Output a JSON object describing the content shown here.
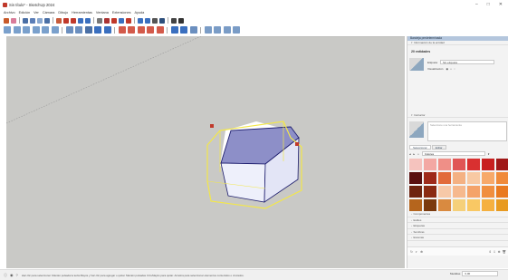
{
  "window": {
    "title": "Sin título* - SketchUp 2024",
    "controls": [
      "–",
      "□",
      "✕"
    ]
  },
  "menu": [
    "Archivo",
    "Edición",
    "Ver",
    "Cámara",
    "Dibujo",
    "Herramientas",
    "Ventana",
    "Extensiones",
    "Ayuda"
  ],
  "toolbar1_icons": [
    {
      "name": "select-icon",
      "color": "#c85a2a"
    },
    {
      "name": "eraser-icon",
      "color": "#d97c9a"
    },
    {
      "name": "pencil-icon",
      "color": "#4a6fa5"
    },
    {
      "name": "rectangle-icon",
      "color": "#5c7fb8"
    },
    {
      "name": "circle-icon",
      "color": "#8aa8d0"
    },
    {
      "name": "arc-icon",
      "color": "#4a6fa5"
    },
    {
      "name": "pushpull-icon",
      "color": "#c75b3a"
    },
    {
      "name": "move-icon",
      "color": "#c0392b"
    },
    {
      "name": "rotate-icon",
      "color": "#c0392b"
    },
    {
      "name": "scale-icon",
      "color": "#3a6fbf"
    },
    {
      "name": "offset-icon",
      "color": "#3a6fbf"
    },
    {
      "name": "tape-icon",
      "color": "#777777"
    },
    {
      "name": "dimension-icon",
      "color": "#aa3333"
    },
    {
      "name": "protractor-icon",
      "color": "#c0392b"
    },
    {
      "name": "text-icon",
      "color": "#3a6fbf"
    },
    {
      "name": "axes-icon",
      "color": "#c0392b"
    },
    {
      "name": "orbit-icon",
      "color": "#3a6fbf"
    },
    {
      "name": "pan-icon",
      "color": "#3a6fbf"
    },
    {
      "name": "zoom-icon",
      "color": "#555555"
    },
    {
      "name": "zoom-extents-icon",
      "color": "#2d4f7c"
    },
    {
      "name": "warehouse-icon",
      "color": "#444444"
    },
    {
      "name": "person-icon",
      "color": "#333333"
    }
  ],
  "toolbar2_icons": [
    {
      "name": "iso-view-icon",
      "color": "#7aa0cc"
    },
    {
      "name": "top-view-icon",
      "color": "#7aa0cc"
    },
    {
      "name": "front-view-icon",
      "color": "#7aa0cc"
    },
    {
      "name": "right-view-icon",
      "color": "#7aa0cc"
    },
    {
      "name": "back-view-icon",
      "color": "#7aa0cc"
    },
    {
      "name": "left-view-icon",
      "color": "#7aa0cc"
    },
    {
      "name": "xray-icon",
      "color": "#6b8fbf"
    },
    {
      "name": "wireframe-icon",
      "color": "#6b8fbf"
    },
    {
      "name": "hidden-line-icon",
      "color": "#4a6fa5"
    },
    {
      "name": "shaded-icon",
      "color": "#3a6fbf"
    },
    {
      "name": "textured-icon",
      "color": "#3a6fbf"
    },
    {
      "name": "monochrome-icon",
      "color": "#d35a4a"
    },
    {
      "name": "solid-union-icon",
      "color": "#d35a4a"
    },
    {
      "name": "solid-subtract-icon",
      "color": "#d35a4a"
    },
    {
      "name": "solid-trim-icon",
      "color": "#d35a4a"
    },
    {
      "name": "solid-split-icon",
      "color": "#d35a4a"
    },
    {
      "name": "section-plane-icon",
      "color": "#3a6fbf"
    },
    {
      "name": "section-cut-icon",
      "color": "#3a6fbf"
    },
    {
      "name": "sandbox-icon",
      "color": "#6b8fbf"
    },
    {
      "name": "styles-icon",
      "color": "#7a9cc6"
    },
    {
      "name": "shadows-icon",
      "color": "#7a9cc6"
    },
    {
      "name": "fog-icon",
      "color": "#7a9cc6"
    },
    {
      "name": "layers-icon",
      "color": "#7a9cc6"
    }
  ],
  "panel": {
    "header": "Bandeja predeterminada",
    "entity_info_title": "Información de la entidad",
    "entity_count": "20 entidades",
    "layer_label": "Etiqueta",
    "layer_value": "Sin etiqueta",
    "visibility_label": "Visualización",
    "instructor_title": "Instructor",
    "instructor_text": "Seleccione una herramienta",
    "mat_tabs": [
      "Seleccionar",
      "Editar"
    ],
    "mat_category": "Colores",
    "swatches": [
      "#f5c3be",
      "#f3a8a3",
      "#ef8f87",
      "#e05555",
      "#d93030",
      "#c81f1f",
      "#a01818",
      "#5a1010",
      "#9e2a1a",
      "#e26b3a",
      "#f4b183",
      "#f8c9a3",
      "#f7a96a",
      "#f08a3a",
      "#6e2410",
      "#8a2a12",
      "#f7c9a8",
      "#f6b98e",
      "#f4a36a",
      "#f08f40",
      "#e97a20",
      "#b5651d",
      "#7a3a0e",
      "#d98a40",
      "#f5d07a",
      "#f9c864",
      "#f5b040",
      "#e89a20"
    ],
    "sections": [
      "Componentes",
      "Estilos",
      "Etiquetas",
      "Sombras",
      "Escenas"
    ],
    "color_foot_left": [
      "↻",
      "◐",
      "⊕"
    ],
    "color_foot_right": [
      "⇕",
      "⇩",
      "⊕",
      "🗑"
    ]
  },
  "status": {
    "icons": [
      "ⓘ",
      "◉",
      "?"
    ],
    "message": "Haz clic para seleccionar. Mantén pulsada la tecla Mayús y haz clic para agregar o quitar. Mantén pulsadas Ctrl+Mayús para quitar. Arrastra para seleccionar elementos contenidos o cruzados.",
    "measure_label": "Medidas",
    "measure_value": "0,00"
  }
}
